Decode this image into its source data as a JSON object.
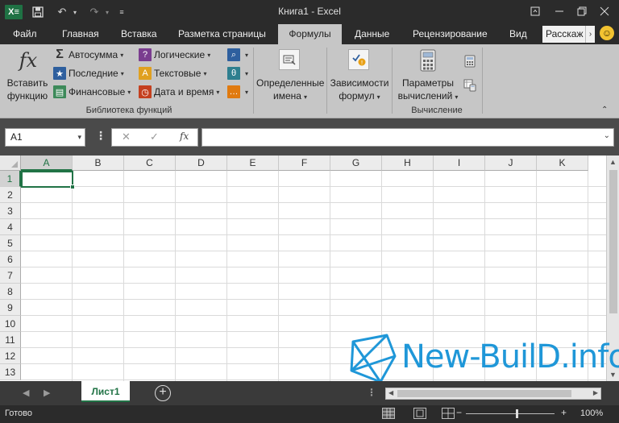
{
  "window": {
    "title": "Книга1 - Excel",
    "app_logo": "X≡"
  },
  "tabs": [
    {
      "label": "Файл",
      "active": false
    },
    {
      "label": "Главная",
      "active": false
    },
    {
      "label": "Вставка",
      "active": false
    },
    {
      "label": "Разметка страницы",
      "active": false
    },
    {
      "label": "Формулы",
      "active": true
    },
    {
      "label": "Данные",
      "active": false
    },
    {
      "label": "Рецензирование",
      "active": false
    },
    {
      "label": "Вид",
      "active": false
    }
  ],
  "tell_me": "Расскаж",
  "ribbon": {
    "insert_function": {
      "line1": "Вставить",
      "line2": "функцию"
    },
    "autosum": "Автосумма",
    "recent": "Последние",
    "financial": "Финансовые",
    "logical": "Логические",
    "text": "Текстовые",
    "datetime": "Дата и время",
    "library_group": "Библиотека функций",
    "defined_names": {
      "line1": "Определенные",
      "line2": "имена"
    },
    "dependencies": {
      "line1": "Зависимости",
      "line2": "формул"
    },
    "calc_options": {
      "line1": "Параметры",
      "line2": "вычислений"
    },
    "calc_group": "Вычисление"
  },
  "formula_bar": {
    "name_box": "A1",
    "fx": "fx",
    "formula": ""
  },
  "columns": [
    "A",
    "B",
    "C",
    "D",
    "E",
    "F",
    "G",
    "H",
    "I",
    "J",
    "K"
  ],
  "rows": [
    "1",
    "2",
    "3",
    "4",
    "5",
    "6",
    "7",
    "8",
    "9",
    "10",
    "11",
    "12",
    "13"
  ],
  "active_cell": "A1",
  "sheets": [
    {
      "label": "Лист1",
      "active": true
    }
  ],
  "watermark": "New-BuilD.info",
  "status": {
    "ready": "Готово",
    "zoom": "100%"
  },
  "colors": {
    "accent": "#217346",
    "watermark": "#1f97d8"
  }
}
